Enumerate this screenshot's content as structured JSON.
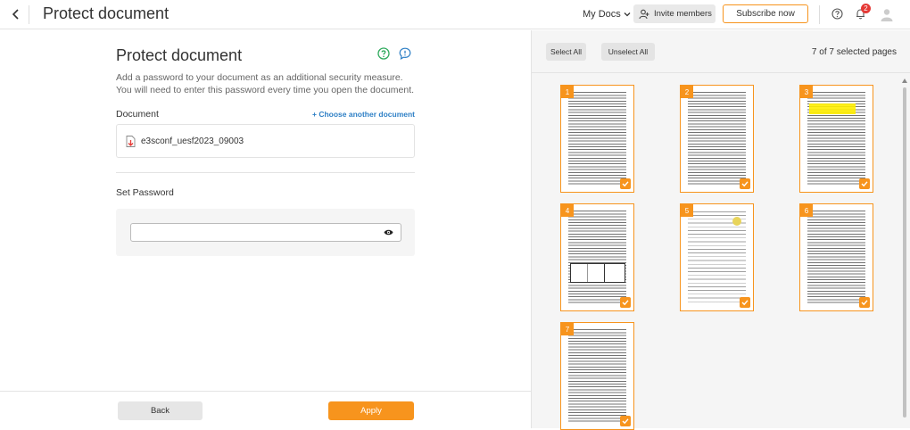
{
  "header": {
    "title": "Protect document",
    "my_docs": "My Docs",
    "invite_label": "Invite members",
    "subscribe_label": "Subscribe now",
    "notification_count": "2"
  },
  "form": {
    "title": "Protect document",
    "description": "Add a password to your document as an additional security measure. You will need to enter this password every time you open the document.",
    "document_label": "Document",
    "choose_link": "+ Choose another document",
    "file_name": "e3sconf_uesf2023_09003",
    "password_label": "Set Password",
    "password_value": ""
  },
  "footer": {
    "back_label": "Back",
    "apply_label": "Apply"
  },
  "pages_panel": {
    "select_all": "Select All",
    "unselect_all": "Unselect All",
    "selected_count": "7 of 7 selected pages",
    "pages": [
      {
        "number": "1",
        "selected": true
      },
      {
        "number": "2",
        "selected": true
      },
      {
        "number": "3",
        "selected": true
      },
      {
        "number": "4",
        "selected": true
      },
      {
        "number": "5",
        "selected": true
      },
      {
        "number": "6",
        "selected": true
      },
      {
        "number": "7",
        "selected": true
      }
    ]
  },
  "colors": {
    "accent": "#f7941d",
    "link": "#2f80c6",
    "help_green": "#2eaa5c",
    "feedback_blue": "#2f80c6",
    "badge_red": "#e53935"
  },
  "icons": [
    "chevron-left-icon",
    "chevron-down-icon",
    "add-user-icon",
    "help-icon",
    "bell-icon",
    "avatar-icon",
    "question-circle-icon",
    "chat-icon",
    "pdf-file-icon",
    "eye-icon",
    "check-icon"
  ]
}
